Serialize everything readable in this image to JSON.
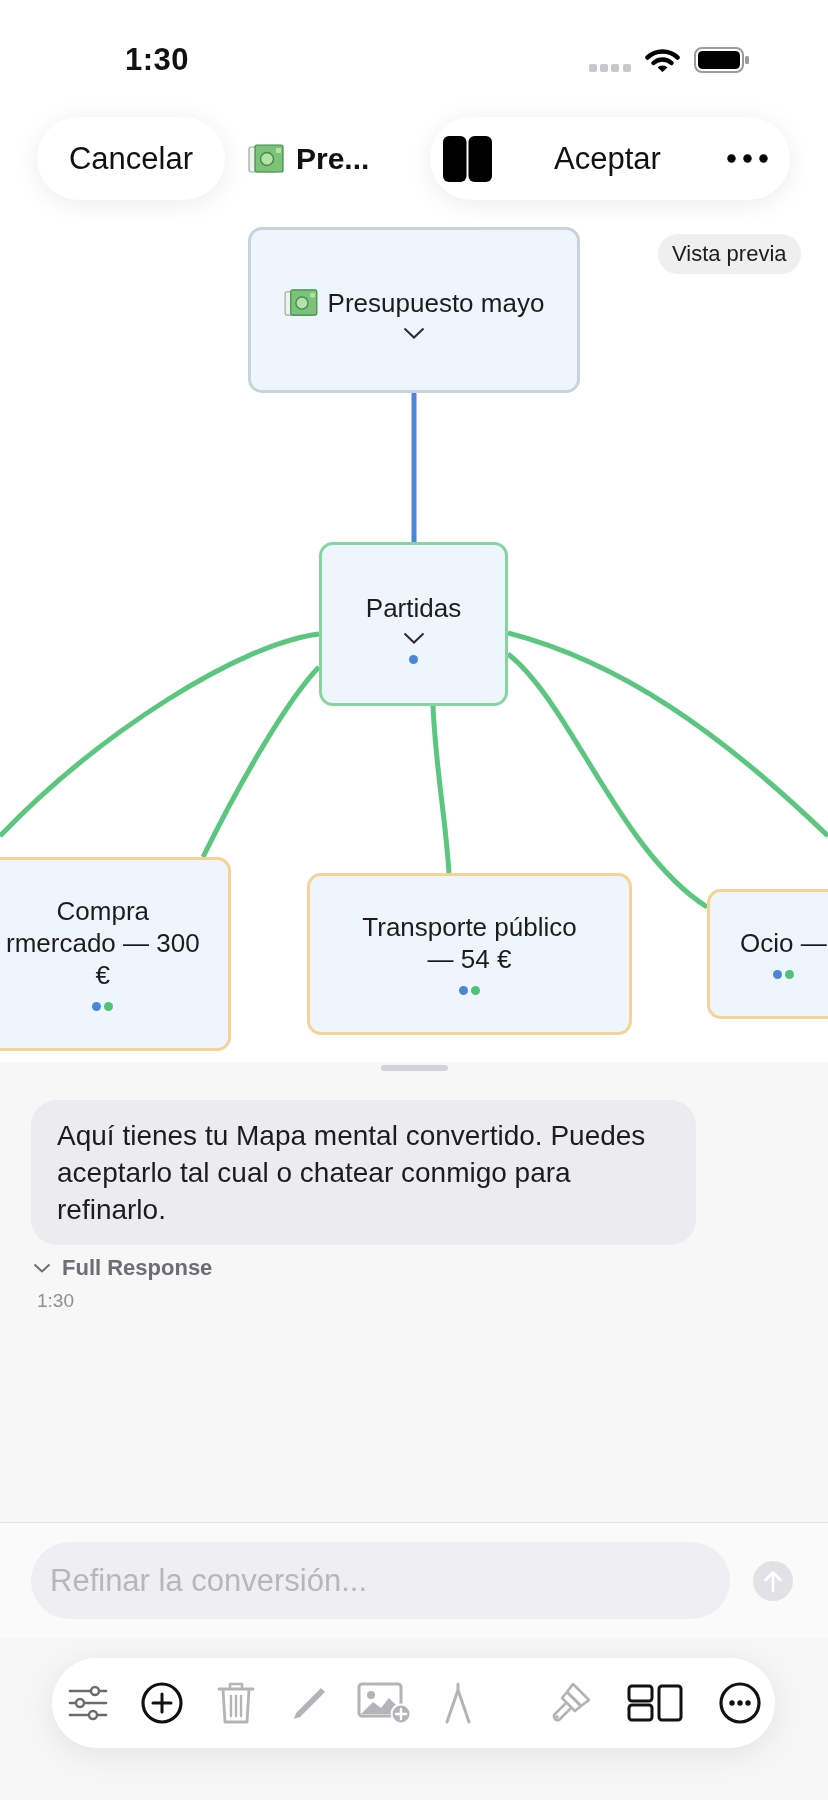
{
  "status_bar": {
    "time": "1:30"
  },
  "top_bar": {
    "cancel": "Cancelar",
    "title": "Pre...",
    "accept": "Aceptar"
  },
  "mind_map": {
    "badge": "Vista previa",
    "root": {
      "label": "Presupuesto mayo",
      "expanded": true
    },
    "branch": {
      "label": "Partidas",
      "expanded": true,
      "dots": [
        {
          "color": "#4a86d8"
        }
      ]
    },
    "leaves": [
      {
        "lines": [
          "Compra",
          "rmercado — 300",
          "€"
        ],
        "dots": [
          {
            "color": "#4a86d8"
          },
          {
            "color": "#4fc276"
          }
        ]
      },
      {
        "lines": [
          "Transporte público",
          "— 54 €"
        ],
        "dots": [
          {
            "color": "#4a86d8"
          },
          {
            "color": "#4fc276"
          }
        ]
      },
      {
        "lines": [
          "Ocio —"
        ],
        "dots": [
          {
            "color": "#4a86d8"
          },
          {
            "color": "#4fc276"
          }
        ]
      }
    ]
  },
  "chat": {
    "message": "Aquí tienes tu Mapa mental convertido. Puedes aceptarlo tal cual o chatear conmigo para refinarlo.",
    "full_response": {
      "label": "Full Response",
      "expanded": false
    },
    "time": "1:30"
  },
  "composer": {
    "placeholder": "Refinar la conversión...",
    "send_disabled": true
  },
  "toolbar": [
    {
      "kind": "sliders",
      "disabled": false
    },
    {
      "kind": "add",
      "disabled": false
    },
    {
      "kind": "trash",
      "disabled": true
    },
    {
      "kind": "pencil",
      "disabled": true
    },
    {
      "kind": "image",
      "disabled": true
    },
    {
      "kind": "compass",
      "disabled": true
    },
    {
      "kind": "brush",
      "disabled": true
    },
    {
      "kind": "layout",
      "disabled": false
    },
    {
      "kind": "more",
      "disabled": false
    }
  ]
}
